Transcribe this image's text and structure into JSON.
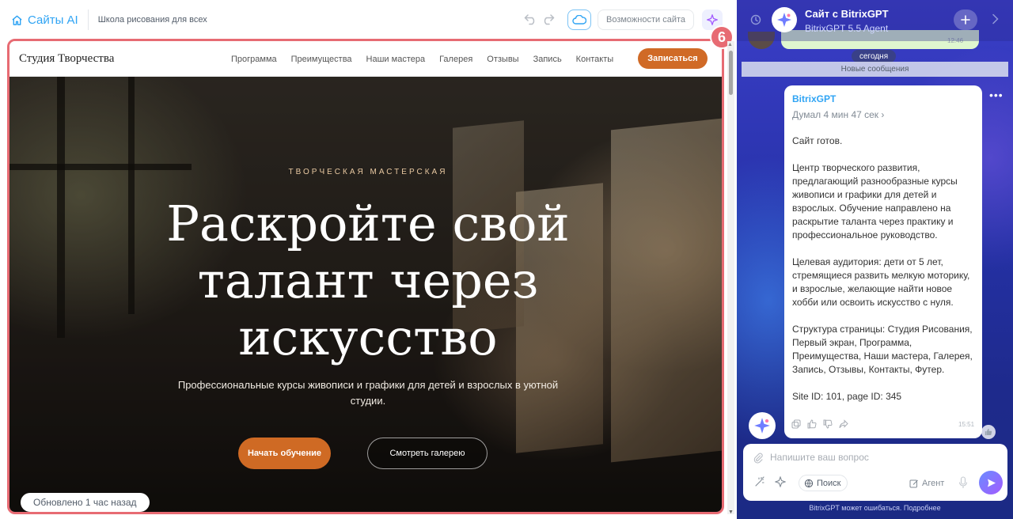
{
  "topbar": {
    "brand": "Сайты AI",
    "project_name": "Школа рисования для всех",
    "features_button": "Возможности сайта"
  },
  "site": {
    "logo": "Студия Творчества",
    "menu": [
      "Программа",
      "Преимущества",
      "Наши мастера",
      "Галерея",
      "Отзывы",
      "Запись",
      "Контакты"
    ],
    "cta": "Записаться",
    "hero": {
      "eyebrow": "ТВОРЧЕСКАЯ МАСТЕРСКАЯ",
      "title": "Раскройте свой талант через искусство",
      "subtitle": "Профессиональные курсы живописи и графики для детей и взрослых в уютной студии.",
      "primary_button": "Начать обучение",
      "secondary_button": "Смотреть галерею"
    },
    "updated_label": "Обновлено 1 час назад"
  },
  "step_badge": "6",
  "chat": {
    "title": "Сайт с BitrixGPT",
    "subtitle": "BitrixGPT 5.5 Agent",
    "prev_time": "12:46",
    "today": "сегодня",
    "new_messages": "Новые сообщения",
    "message": {
      "author": "BitrixGPT",
      "thinking": "Думал 4 мин 47 сек  ›",
      "body": "Сайт готов.\n\nЦентр творческого развития, предлагающий разнообразные курсы живописи и графики для детей и взрослых. Обучение направлено на раскрытие таланта через практику и профессиональное руководство.\n\nЦелевая аудитория: дети от 5 лет, стремящиеся развить мелкую моторику, и взрослые, желающие найти новое хобби или освоить искусство с нуля.\n\nСтруктура страницы: Студия Рисования, Первый экран, Программа, Преимущества, Наши мастера, Галерея, Запись, Отзывы, Контакты, Футер.\n\nSite ID: 101, page ID: 345",
      "time": "15:51"
    },
    "input_placeholder": "Напишите ваш вопрос",
    "search_label": "Поиск",
    "agent_label": "Агент",
    "disclaimer": "BitrixGPT может ошибаться. Подробнее"
  },
  "colors": {
    "accent_blue": "#2fa4f4",
    "cta_orange": "#d06a26",
    "highlight_red": "#e76b73",
    "chat_bg": "#2531a6"
  }
}
